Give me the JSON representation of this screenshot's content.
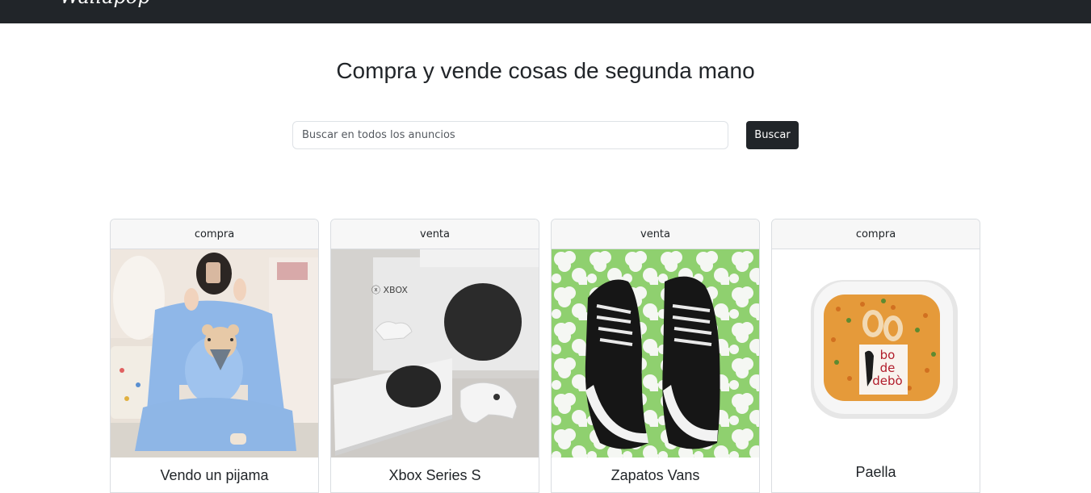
{
  "navbar": {
    "brand": "Wallapop"
  },
  "hero": {
    "title": "Compra y vende cosas de segunda mano"
  },
  "search": {
    "placeholder": "Buscar en todos los anuncios",
    "button_label": "Buscar"
  },
  "listings": [
    {
      "type": "compra",
      "title": "Vendo un pijama",
      "image": "woman-in-blue-bear-pajamas"
    },
    {
      "type": "venta",
      "title": "Xbox Series S",
      "image": "xbox-series-s-console-with-box"
    },
    {
      "type": "venta",
      "title": "Zapatos Vans",
      "image": "black-vans-sneakers"
    },
    {
      "type": "compra",
      "title": "Paella",
      "image": "paella-tray-bodedebo"
    }
  ]
}
